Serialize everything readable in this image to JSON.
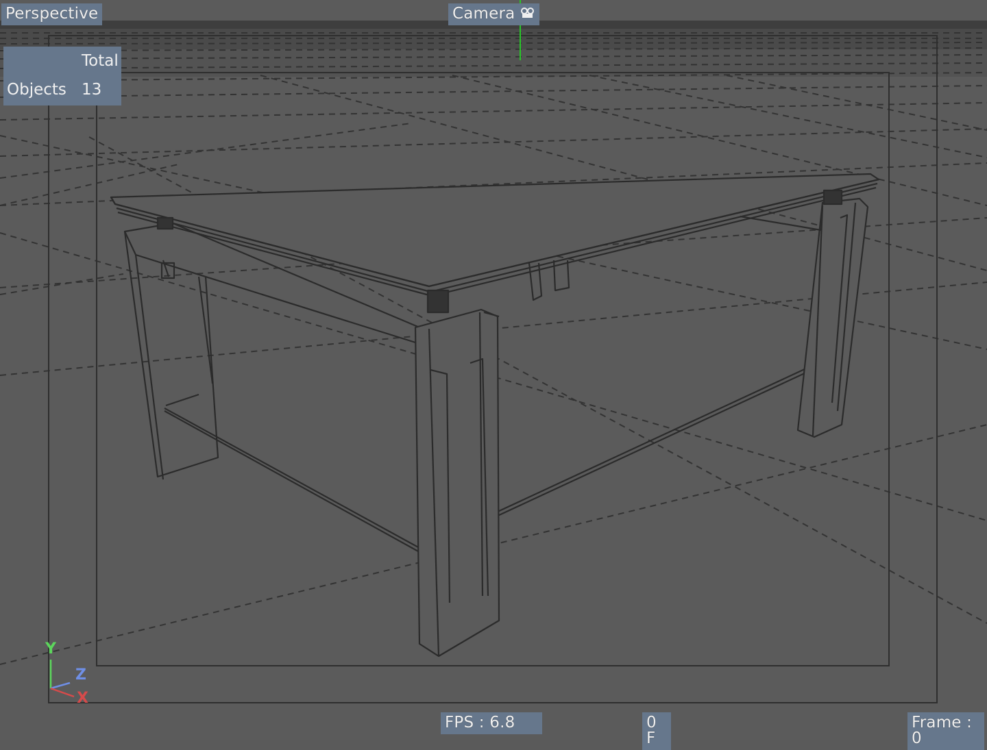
{
  "viewport": {
    "view_name": "Perspective",
    "camera_label": "Camera",
    "camera_icon": "camera-icon"
  },
  "info_panel": {
    "header": "Total",
    "objects_label": "Objects",
    "objects_value": "13"
  },
  "status": {
    "fps": "FPS : 6.8",
    "frame_counter": "0 F",
    "frame": "Frame : 0"
  },
  "axis_gizmo": {
    "y_label": "Y",
    "z_label": "Z",
    "x_label": "X"
  },
  "colors": {
    "background": "#5b5b5b",
    "label_bg": "#66778c",
    "wireframe": "#2b2b2b",
    "grid": "#333333",
    "axis_y": "#5cd65c",
    "axis_z": "#6f8fe6",
    "axis_x": "#d64b4b"
  }
}
